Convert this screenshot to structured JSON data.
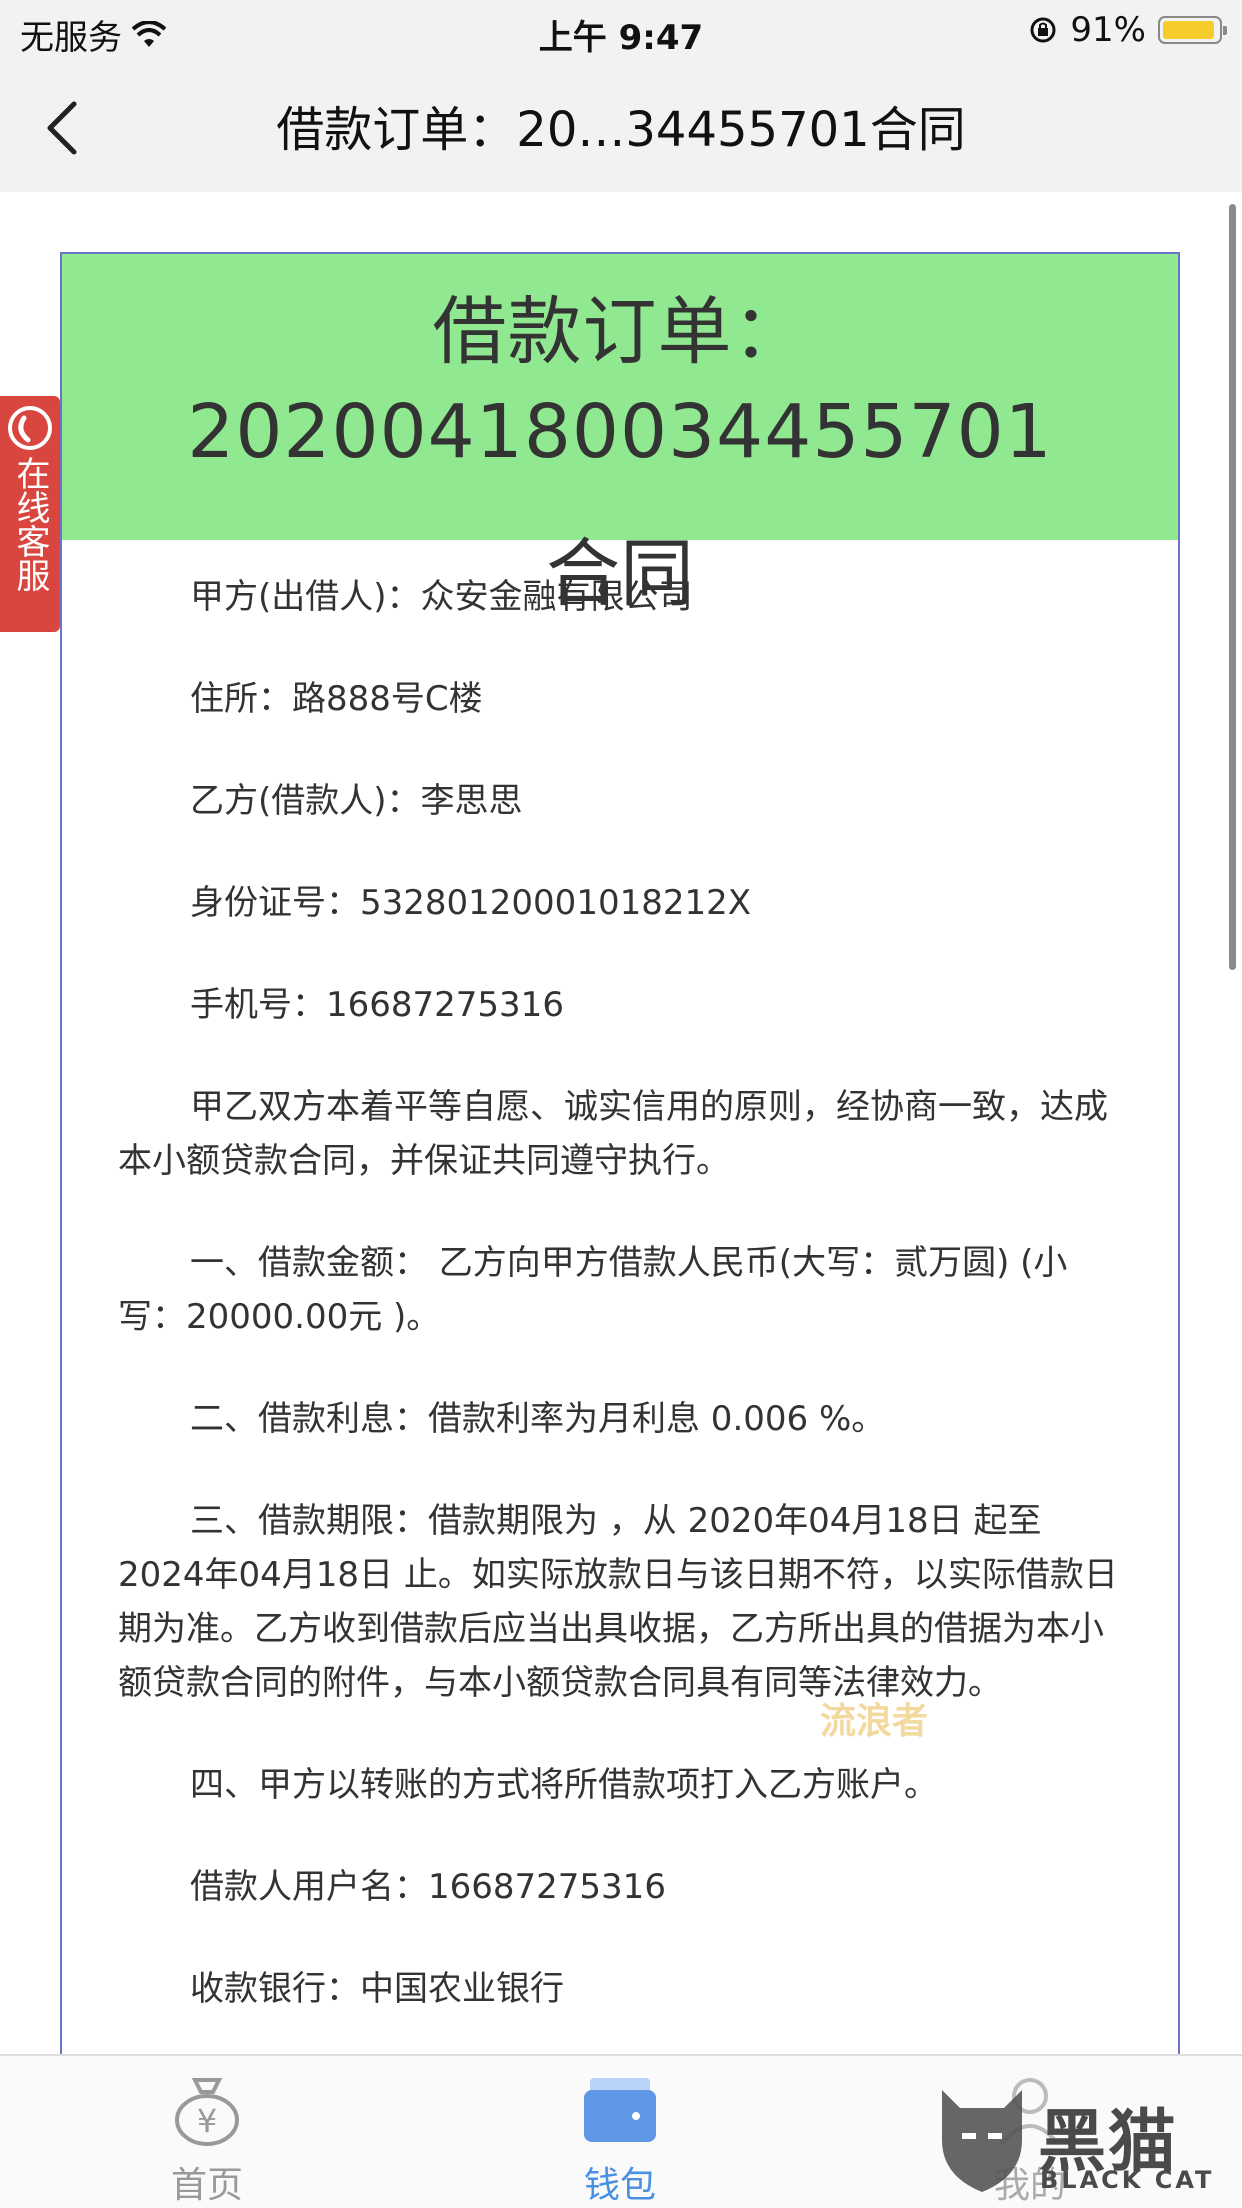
{
  "status_bar": {
    "carrier": "无服务",
    "time": "上午 9:47",
    "battery": "91%"
  },
  "nav": {
    "title": "借款订单：20…34455701合同"
  },
  "service_tab": {
    "label": "在线客服"
  },
  "contract": {
    "title_line1": "借款订单：2020041800344557​01",
    "title_line2": "合同",
    "lender": "甲方(出借人)：众安金融有限公司",
    "address": "住所：路888号C楼",
    "borrower": "乙方(借款人)：李思思",
    "id_number": "身份证号：53280120001018212X",
    "phone": "手机号：16687275316",
    "intro": "甲乙双方本着平等自愿、诚实信用的原则，经协商一致，达成本小额贷款合同，并保证共同遵守执行。",
    "clause1": "一、借款金额： 乙方向甲方借款人民币(大写：贰万圆) (小写：20000.00元 )。",
    "clause2": "二、借款利息：借款利率为月利息 0.006 %。",
    "clause3": "三、借款期限：借款期限为 ，从 2020年04月18日 起至 2024年04月18日 止。如实际放款日与该日期不符，以实际借款日期为准。乙方收到借款后应当出具收据，乙方所出具的借据为本小额贷款合同的附件，与本小额贷款合同具有同等法律效力。",
    "clause4": "四、甲方以转账的方式将所借款项打入乙方账户。",
    "username": "借款人用户名：16687275316",
    "bank_partial": "收款银行：中国农业银行"
  },
  "watermark": "流浪者",
  "tabs": [
    {
      "label": "首页",
      "icon": "money-bag-icon"
    },
    {
      "label": "钱包",
      "icon": "wallet-icon"
    },
    {
      "label": "我的",
      "icon": "user-icon"
    }
  ],
  "brand": {
    "cn": "黑猫",
    "en": "BLACK CAT"
  },
  "colors": {
    "header_green": "#90e891",
    "border_blue": "#6c74c7",
    "tab_active": "#4a90e2",
    "service_red": "#d9453f"
  }
}
